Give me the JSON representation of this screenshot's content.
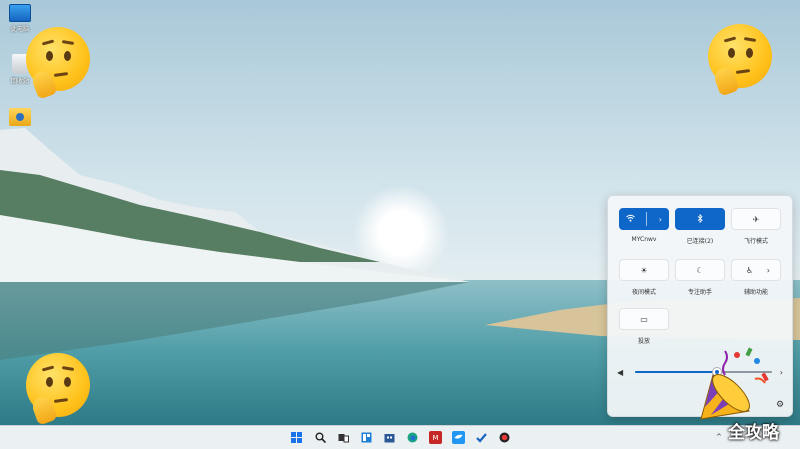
{
  "desktop": {
    "icons": [
      {
        "label": "此电脑",
        "icon": "computer-icon"
      },
      {
        "label": "回收站",
        "icon": "recycle-bin-icon"
      },
      {
        "label": "",
        "icon": "user-folder-icon"
      }
    ]
  },
  "quick_settings": {
    "tiles": [
      {
        "label": "MYCnwv",
        "icon": "wifi-icon",
        "active": true,
        "has_arrow": true
      },
      {
        "label": "已连接(2)",
        "icon": "bluetooth-icon",
        "active": true,
        "has_arrow": false
      },
      {
        "label": "飞行模式",
        "icon": "airplane-icon",
        "active": false,
        "has_arrow": false
      },
      {
        "label": "夜间模式",
        "icon": "night-light-icon",
        "active": false,
        "has_arrow": false
      },
      {
        "label": "专注助手",
        "icon": "focus-assist-icon",
        "active": false,
        "has_arrow": false
      },
      {
        "label": "辅助功能",
        "icon": "accessibility-icon",
        "active": false,
        "has_arrow": true
      },
      {
        "label": "投放",
        "icon": "cast-icon",
        "active": false,
        "has_arrow": false
      }
    ],
    "volume": {
      "icon": "speaker-icon",
      "level": 0.6
    },
    "arrow_glyph": "›",
    "settings_icon": "gear-icon"
  },
  "taskbar": {
    "icons": [
      {
        "name": "start-icon",
        "color": "#1a73e8"
      },
      {
        "name": "search-icon",
        "color": "#222222"
      },
      {
        "name": "task-view-icon",
        "color": "#333333"
      },
      {
        "name": "widgets-icon",
        "color": "#1e7fd6"
      },
      {
        "name": "store-icon",
        "color": "#2b5797"
      },
      {
        "name": "edge-icon",
        "color": "#1aa37f"
      },
      {
        "name": "mail-icon",
        "color": "#c62828"
      },
      {
        "name": "app-icon",
        "color": "#2196f3"
      },
      {
        "name": "checkmark-app-icon",
        "color": "#1565c0"
      },
      {
        "name": "record-icon",
        "color": "#b71c1c"
      }
    ],
    "tray_chevron": "^"
  },
  "watermark": "全攻略",
  "colors": {
    "accent": "#0f66c9",
    "panel": "#f3f6f9"
  }
}
